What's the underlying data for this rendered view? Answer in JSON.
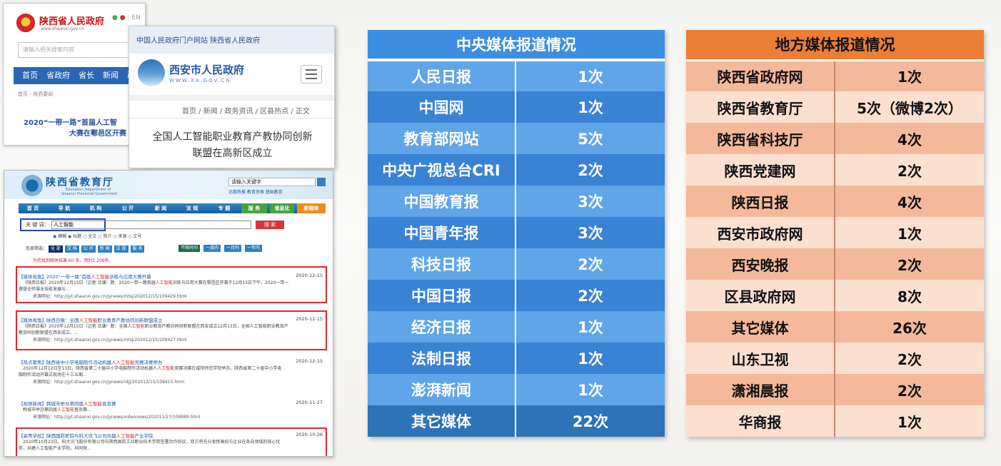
{
  "shaanxi_gov": {
    "title": "陕西省人民政府",
    "url": "www.shaanxi.gov.cn",
    "lang": "EN",
    "search_placeholder": "请输入相关搜索内容",
    "nav": [
      "首页",
      "省政府",
      "省长",
      "新闻",
      "政"
    ],
    "breadcrumb": "首页 › 陕西要闻",
    "headline_1": "2020“一带一路”首届人工智",
    "headline_2": "大赛在鄠邑区开赛"
  },
  "xian_gov": {
    "top_links": "中国人民政府门户网站    陕西省人民政府",
    "title": "西安市人民政府",
    "url": "WWW.XA.GOV.CN",
    "breadcrumb": "首页 / 新闻 / 政务资讯 / 区县热点 / 正文",
    "headline_1": "全国人工智能职业教育产教协同创新",
    "headline_2": "联盟在高新区成立"
  },
  "edu_dept": {
    "title": "陕西省教育厅",
    "en_1": "Education Department of",
    "en_2": "Shaanxi Provincial Government",
    "search_value": "请输入关键字",
    "links": "远期热推  教育资格  基础教育",
    "nav": [
      "首 页",
      "导 航",
      "机 构",
      "公 开",
      "新 闻",
      "法 规",
      "专 题",
      "服 务",
      "信息化",
      "新媒体"
    ],
    "keyword_label": "关 键 词：",
    "keyword_value": "人工智能",
    "search_button": "搜  索",
    "radio_options": "◉ 模糊  ◉ 标题  ○ 全文  ○ 简介  ○ 来源  ○ 文号",
    "filter_label": "信息筛选：",
    "filters": [
      "全 部",
      "文 档",
      "公 开",
      "新 闻",
      "法 规",
      "服 务"
    ],
    "time_filters": [
      "不限时间",
      "一周内",
      "一月内",
      "一年内"
    ],
    "result_count": "为您找到相关结果 60 条，用时1.206秒。",
    "results": [
      {
        "title_a": "【媒体视角】2020“一带一路”首届",
        "title_hl": "人工智能",
        "title_b": "训练与应用大赛开幕",
        "date": "2020-12-15",
        "text_a": "《陕西日报》2020年12月15日（记者 沈谦）题：2020一带一路首届",
        "text_hl": "人工智能",
        "text_b": "训练与应用大赛在鄠邑区开幕于12月13日下午，2020一带一",
        "text_2": "路暨全师课业技能发展与...",
        "url": "来源网址：http://jyt.shaanxi.gov.cn/jynews/mtsj/202012/15/109429.html"
      },
      {
        "title_a": "【媒体视角】陕西日报：全国",
        "title_hl": "人工智能",
        "title_b": "职业教育产教协同创新联盟成立",
        "date": "2020-12-15",
        "text_a": "《陕西日报》2020年12月15日（记者 沈谦）题：全国",
        "text_hl": "人工智能",
        "text_b": "职业教育产教协同创新联盟在西安成立12月13日，全国人工智能职业教育产",
        "text_2": "教协同创新联盟在西安成立。...",
        "url": "来源网址：http://jyt.shaanxi.gov.cn/jynews/mtsj/202012/15/109427.html"
      },
      {
        "title_a": "【热点聚焦】陕西省中小学电脑制作活动机器人",
        "title_hl": "人工智能",
        "title_b": "竞赛决赛举办",
        "date": "2020-12-15",
        "text_a": "2020年12月12日至13日，陕西省第二十届中小学电脑制作活动机器人",
        "text_hl": "人工智能",
        "text_b": "竞赛决赛在咸阳师范学院举办。陕西省第二十届中小学电",
        "text_2": "脑制作活动开幕式现场在十三五期...",
        "url": "来源网址：http://jyt.shaanxi.gov.cn/jynews/rdjj/202012/15/109415.html"
      },
      {
        "title_a": "【视频新闻】韩城市举办第四届",
        "title_hl": "人工智能",
        "title_b": "普及赛",
        "date": "2020-11-27",
        "text_a": "韩城市举办第四届",
        "text_hl": "人工智能",
        "text_b": "普及赛...",
        "text_2": "",
        "url": "来源网址：http://jyt.shaanxi.gov.cn/jynews/videonews/202011/27/108989.html"
      },
      {
        "title_a": "【高等学校】陕西国防职院与科大讯飞公司共建",
        "title_hl": "人工智能",
        "title_b": "产业学院",
        "date": "2020-10-26",
        "text_a": "2020年10月23日，科大讯飞股份有限公司与陕西国防工业职业技术学院签署合作协议，双方将充分发挥高校与企业在各自领域的核心优",
        "text_hl": "",
        "text_b": "",
        "text_2": "势，共建人工智能产业学院，共同探...",
        "url": ""
      }
    ]
  },
  "central_media": {
    "title": "中央媒体报道情况",
    "rows": [
      {
        "name": "人民日报",
        "count": "1次"
      },
      {
        "name": "中国网",
        "count": "1次"
      },
      {
        "name": "教育部网站",
        "count": "5次"
      },
      {
        "name": "中央广视总台CRI",
        "count": "2次"
      },
      {
        "name": "中国教育报",
        "count": "3次"
      },
      {
        "name": "中国青年报",
        "count": "3次"
      },
      {
        "name": "科技日报",
        "count": "2次"
      },
      {
        "name": "中国日报",
        "count": "2次"
      },
      {
        "name": "经济日报",
        "count": "1次"
      },
      {
        "name": "法制日报",
        "count": "1次"
      },
      {
        "name": "澎湃新闻",
        "count": "1次"
      },
      {
        "name": "其它媒体",
        "count": "22次"
      }
    ],
    "colors": {
      "header": "#3c8ee1",
      "row_light": "#5fa5e8",
      "row_dark": "#3a82d4",
      "bottom": "#2e72b8"
    }
  },
  "local_media": {
    "title": "地方媒体报道情况",
    "rows": [
      {
        "name": "陕西省政府网",
        "count": "1次"
      },
      {
        "name": "陕西省教育厅",
        "count": "5次（微博2次）"
      },
      {
        "name": "陕西省科技厅",
        "count": "4次"
      },
      {
        "name": "陕西党建网",
        "count": "2次"
      },
      {
        "name": "陕西日报",
        "count": "4次"
      },
      {
        "name": "西安市政府网",
        "count": "1次"
      },
      {
        "name": "西安晚报",
        "count": "2次"
      },
      {
        "name": "区县政府网",
        "count": "8次"
      },
      {
        "name": "其它媒体",
        "count": "26次"
      },
      {
        "name": "山东卫视",
        "count": "2次"
      },
      {
        "name": "潇湘晨报",
        "count": "2次"
      },
      {
        "name": "华商报",
        "count": "1次"
      }
    ],
    "colors": {
      "header": "#ec7e36",
      "row_dark": "#f4b99a",
      "row_light": "#fbe0d0"
    }
  }
}
